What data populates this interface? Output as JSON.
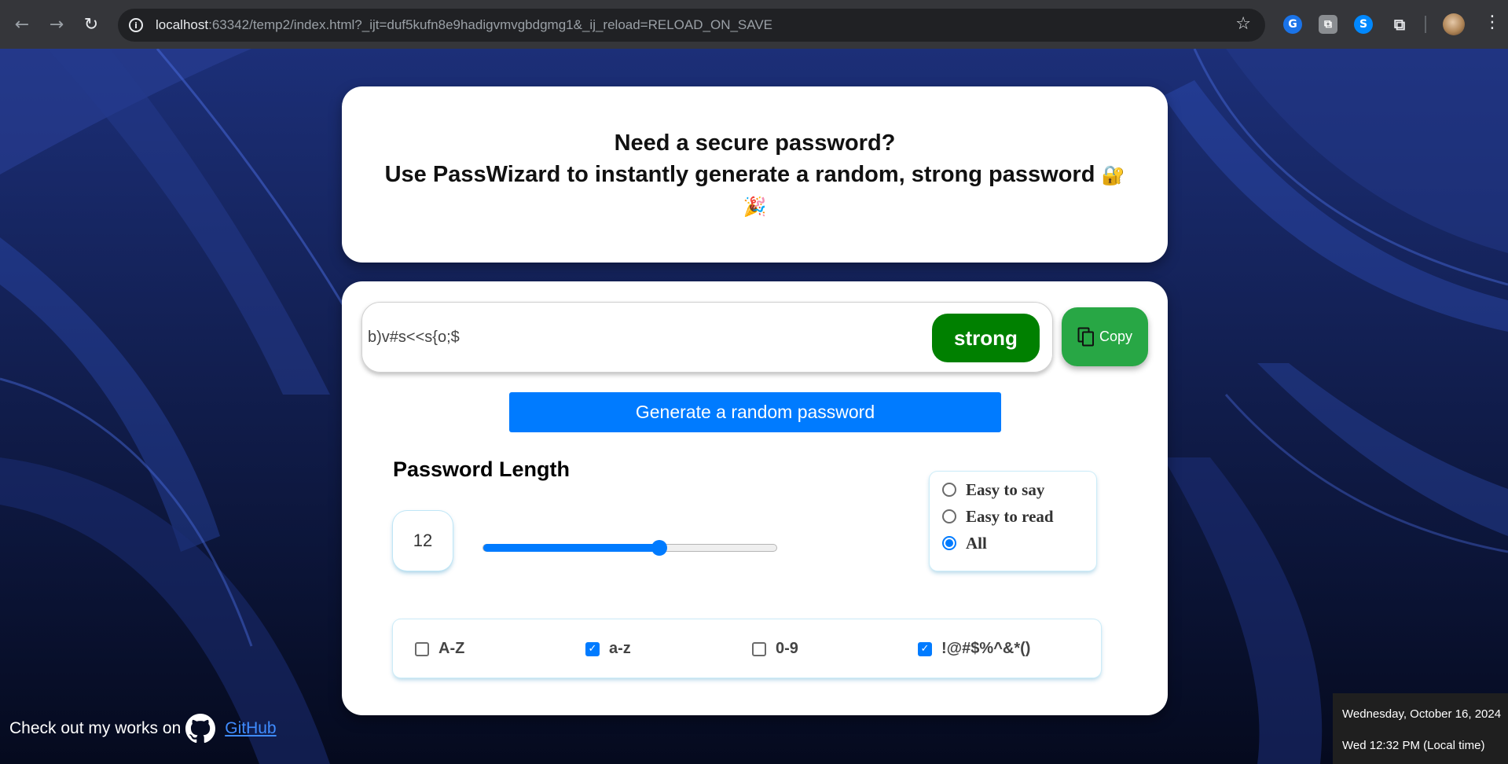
{
  "browser": {
    "back_icon": "back-arrow-icon",
    "forward_icon": "forward-arrow-icon",
    "reload_icon": "reload-icon",
    "url_host": "localhost",
    "url_rest": ":63342/temp2/index.html?_ijt=duf5kufn8e9hadigvmvgbdgmg1&_ij_reload=RELOAD_ON_SAVE",
    "extensions": [
      "grammarly-icon",
      "extension-icon",
      "shazam-icon",
      "puzzle-icon"
    ],
    "ext_labels": {
      "grammarly": "G",
      "second": "⧉",
      "shazam": "S",
      "puzzle": "⧉"
    }
  },
  "header": {
    "line1": "Need a secure password?",
    "line2": "Use PassWizard to instantly generate a random, strong password",
    "emoji_lock": "🔐",
    "emoji_party": "🎉"
  },
  "generator": {
    "password": "b)v#s<<s{o;$",
    "strength": "strong",
    "strength_color": "#008000",
    "copy_label": "Copy",
    "generate_label": "Generate a random password",
    "length_title": "Password Length",
    "length_value": "12",
    "length_fraction": 0.6,
    "modes": [
      {
        "label": "Easy to say",
        "selected": false
      },
      {
        "label": "Easy to read",
        "selected": false
      },
      {
        "label": "All",
        "selected": true
      }
    ],
    "options": [
      {
        "label": "A-Z",
        "checked": false
      },
      {
        "label": "a-z",
        "checked": true
      },
      {
        "label": "0-9",
        "checked": false
      },
      {
        "label": "!@#$%^&*()",
        "checked": true
      }
    ]
  },
  "footer": {
    "text": "Check out my works on",
    "link": "GitHub"
  },
  "clock": {
    "date": "Wednesday, October 16, 2024",
    "time": "Wed 12:32 PM (Local time)"
  },
  "colors": {
    "accent": "#007bff",
    "copy": "#28a745"
  }
}
